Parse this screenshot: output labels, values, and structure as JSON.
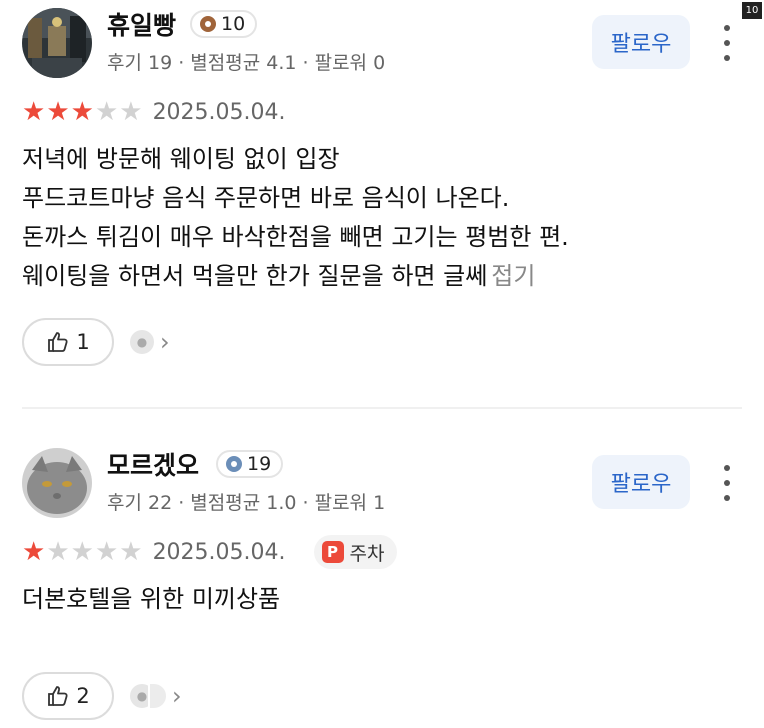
{
  "corner_badge": "10",
  "reviews": [
    {
      "username": "휴일빵",
      "level": "10",
      "meta": "후기 19 · 별점평균 4.1 · 팔로워 0",
      "follow_label": "팔로우",
      "rating": 3,
      "date": "2025.05.04.",
      "text_lines": [
        "저녁에 방문해 웨이팅 없이 입장",
        "푸드코트마냥 음식 주문하면 바로 음식이 나온다.",
        "돈까스 튀김이 매우 바삭한점을 빼면 고기는 평범한 편.",
        "웨이팅을 하면서 먹을만 한가 질문을 하면 글쎄"
      ],
      "fold_label": "접기",
      "like_count": "1"
    },
    {
      "username": "모르겠오",
      "level": "19",
      "meta": "후기 22 · 별점평균 1.0 · 팔로워 1",
      "follow_label": "팔로우",
      "rating": 1,
      "date": "2025.05.04.",
      "tag_icon": "P",
      "tag_label": "주차",
      "text_lines": [
        "더본호텔을 위한 미끼상품"
      ],
      "like_count": "2"
    }
  ],
  "colors": {
    "star_on": "#ec4a3a",
    "star_off": "#d2d2d2",
    "follow_text": "#2b66c9",
    "follow_bg": "#eef3fb"
  },
  "icons": [
    "level-icon",
    "star-icon",
    "thumbs-up-icon",
    "more-vertical-icon",
    "chevron-right-icon",
    "parking-icon",
    "user-icon"
  ]
}
